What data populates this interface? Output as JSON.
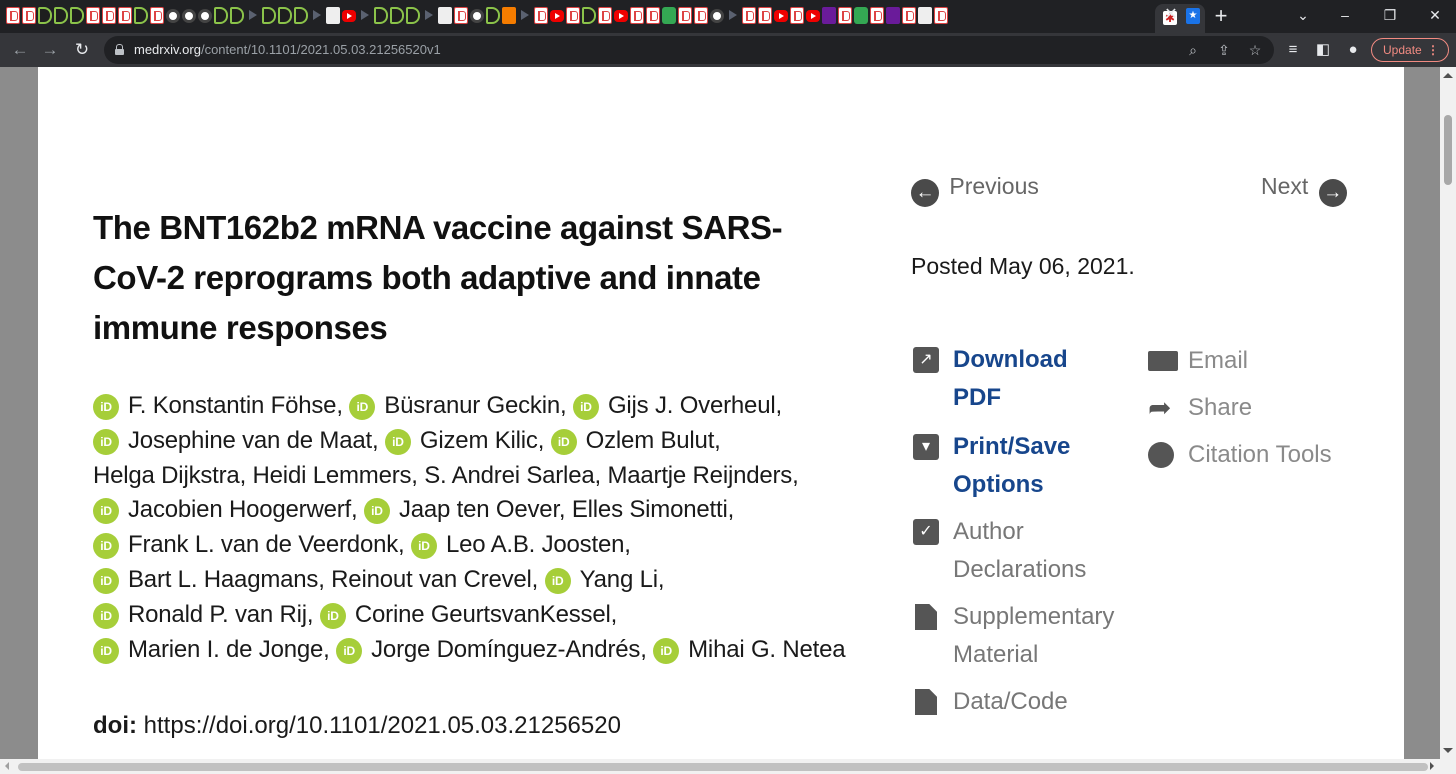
{
  "browser": {
    "url_host": "medrxiv.org",
    "url_path": "/content/10.1101/2021.05.03.21256520v1",
    "tab_close": "✕",
    "new_tab": "+",
    "update_label": "Update",
    "icons": [
      "back-icon",
      "forward-icon",
      "reload-icon",
      "lock-icon",
      "zoom-icon",
      "share-page-icon",
      "bookmark-star-icon",
      "reading-list-icon",
      "side-panel-icon",
      "profile-icon",
      "menu-dots-icon"
    ]
  },
  "article": {
    "title": "The BNT162b2 mRNA vaccine against SARS-CoV-2 reprograms both adaptive and innate immune responses",
    "orcid_label": "iD",
    "authors": [
      {
        "name": "F. Konstantin Föhse,",
        "orcid": true
      },
      {
        "name": "Büsranur Geckin,",
        "orcid": true
      },
      {
        "name": "Gijs J. Overheul,",
        "orcid": true
      },
      {
        "name": "Josephine van de Maat,",
        "orcid": true
      },
      {
        "name": "Gizem Kilic,",
        "orcid": true
      },
      {
        "name": "Ozlem Bulut,",
        "orcid": true
      },
      {
        "name": "Helga Dijkstra,",
        "orcid": false
      },
      {
        "name": "Heidi Lemmers,",
        "orcid": false
      },
      {
        "name": "S. Andrei Sarlea,",
        "orcid": false
      },
      {
        "name": "Maartje Reijnders,",
        "orcid": false
      },
      {
        "name": "Jacobien Hoogerwerf,",
        "orcid": true
      },
      {
        "name": "Jaap ten Oever,",
        "orcid": true
      },
      {
        "name": "Elles Simonetti,",
        "orcid": false
      },
      {
        "name": "Frank L. van de Veerdonk,",
        "orcid": true
      },
      {
        "name": "Leo A.B. Joosten,",
        "orcid": true
      },
      {
        "name": "Bart L. Haagmans,",
        "orcid": true
      },
      {
        "name": "Reinout van Crevel,",
        "orcid": false
      },
      {
        "name": "Yang Li,",
        "orcid": true
      },
      {
        "name": "Ronald P. van Rij,",
        "orcid": true
      },
      {
        "name": "Corine GeurtsvanKessel,",
        "orcid": true
      },
      {
        "name": "Marien I. de Jonge,",
        "orcid": true
      },
      {
        "name": "Jorge Domínguez-Andrés,",
        "orcid": true
      },
      {
        "name": "Mihai G. Netea",
        "orcid": true
      }
    ],
    "doi_label": "doi:",
    "doi_value": "https://doi.org/10.1101/2021.05.03.21256520"
  },
  "sidebar": {
    "previous": "Previous",
    "next": "Next",
    "posted": "Posted May 06, 2021.",
    "download_pdf": "Download PDF",
    "print_save": "Print/Save Options",
    "author_declarations": "Author Declarations",
    "supplementary": "Supplementary Material",
    "data_code": "Data/Code",
    "email": "Email",
    "share": "Share",
    "citation_tools": "Citation Tools"
  }
}
